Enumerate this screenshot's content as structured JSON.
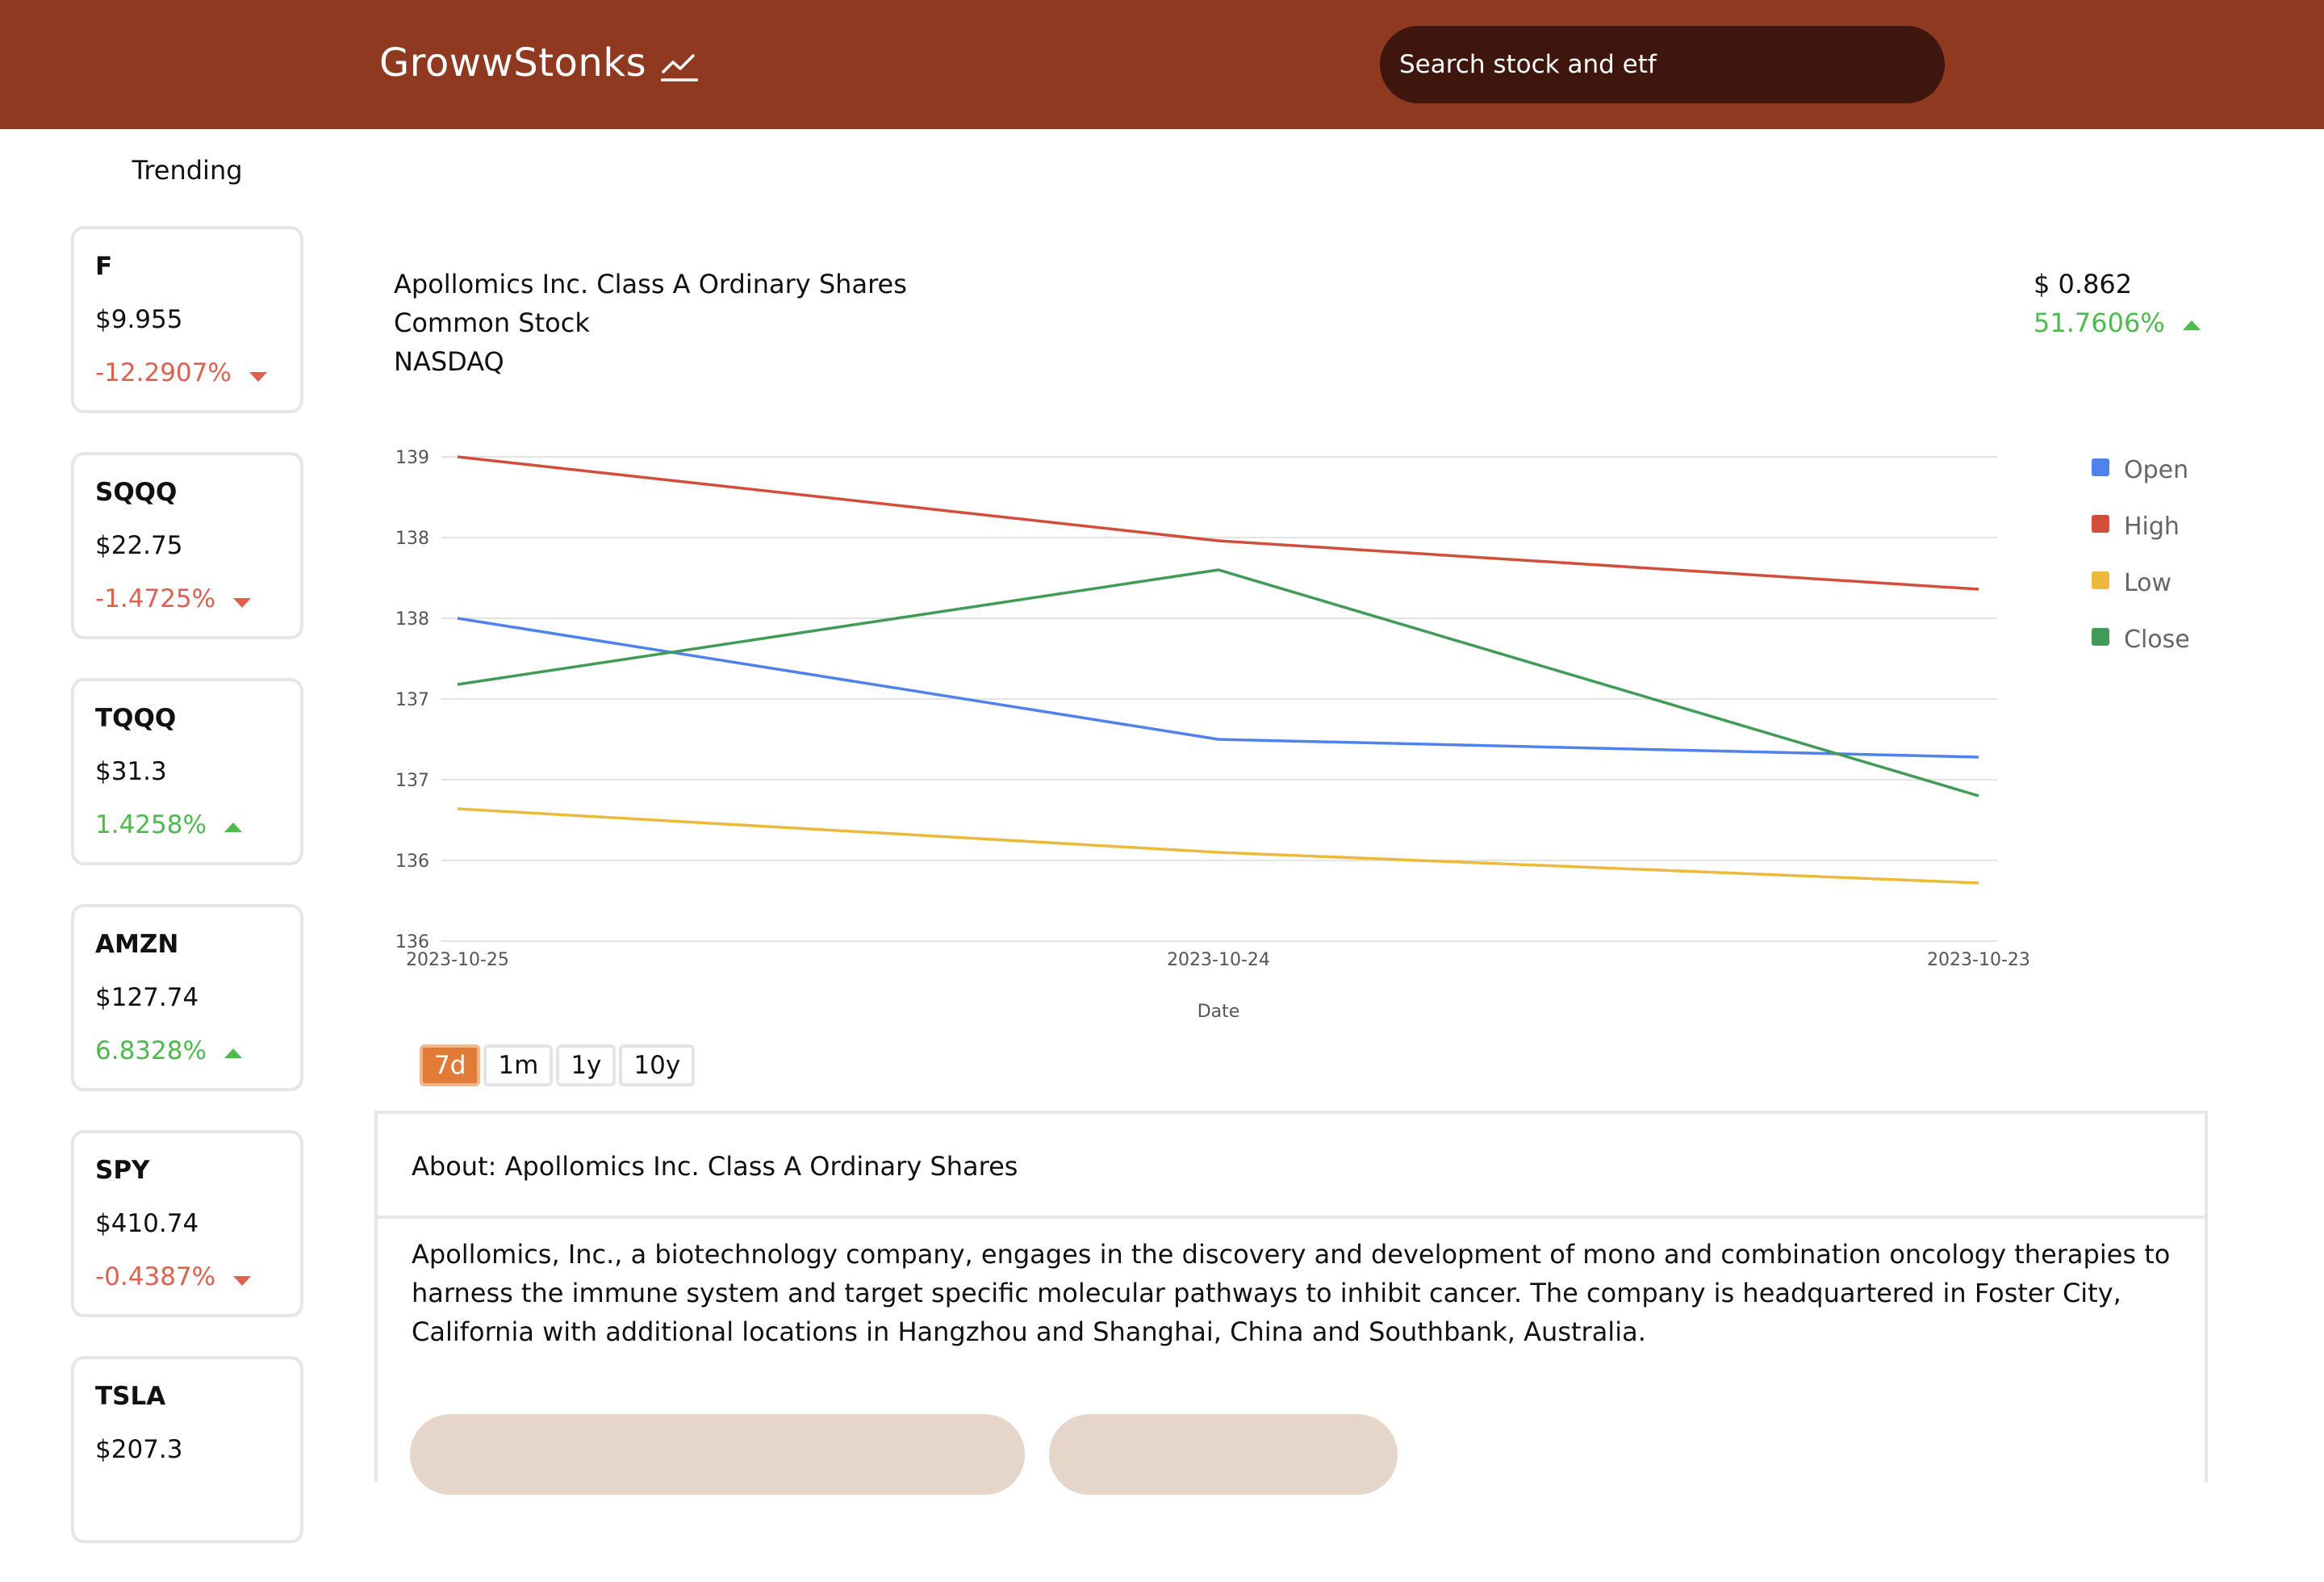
{
  "navbar": {
    "brand": "GrowwStonks",
    "brand_icon": "trending-chart-icon",
    "search_placeholder": "Search stock and etf",
    "background": "#8f3a20",
    "search_background": "#3e160d"
  },
  "trending": {
    "heading": "Trending",
    "items": [
      {
        "symbol": "F",
        "price": "$9.955",
        "change": "-12.2907%",
        "direction": "down"
      },
      {
        "symbol": "SQQQ",
        "price": "$22.75",
        "change": "-1.4725%",
        "direction": "down"
      },
      {
        "symbol": "TQQQ",
        "price": "$31.3",
        "change": "1.4258%",
        "direction": "up"
      },
      {
        "symbol": "AMZN",
        "price": "$127.74",
        "change": "6.8328%",
        "direction": "up"
      },
      {
        "symbol": "SPY",
        "price": "$410.74",
        "change": "-0.4387%",
        "direction": "down"
      },
      {
        "symbol": "TSLA",
        "price": "$207.3",
        "change": "",
        "direction": ""
      }
    ]
  },
  "stock": {
    "name": "Apollomics Inc. Class A Ordinary Shares",
    "asset_type": "Common Stock",
    "exchange": "NASDAQ",
    "price": "$ 0.862",
    "change": "51.7606%",
    "direction": "up"
  },
  "chart_data": {
    "type": "line",
    "x": [
      "2023-10-25",
      "2023-10-24",
      "2023-10-23"
    ],
    "xlabel": "Date",
    "ylabel": "",
    "ylim": [
      135.8,
      138.8
    ],
    "y_ticks": [
      135.8,
      136.3,
      136.8,
      137.3,
      137.8,
      138.3,
      138.8
    ],
    "y_tick_labels": [
      "136",
      "136",
      "137",
      "137",
      "138",
      "138",
      "139"
    ],
    "grid": true,
    "legend_position": "right",
    "series": [
      {
        "name": "Open",
        "color": "#5082ee",
        "values": [
          137.8,
          137.05,
          136.94
        ]
      },
      {
        "name": "High",
        "color": "#d24d3a",
        "values": [
          138.8,
          138.28,
          137.98
        ]
      },
      {
        "name": "Low",
        "color": "#ecb93a",
        "values": [
          136.62,
          136.35,
          136.16
        ]
      },
      {
        "name": "Close",
        "color": "#3f9b55",
        "values": [
          137.39,
          138.1,
          136.7
        ]
      }
    ]
  },
  "range_buttons": [
    {
      "label": "7d",
      "active": true
    },
    {
      "label": "1m",
      "active": false
    },
    {
      "label": "1y",
      "active": false
    },
    {
      "label": "10y",
      "active": false
    }
  ],
  "about": {
    "title": "About: Apollomics Inc. Class A Ordinary Shares",
    "description": "Apollomics, Inc., a biotechnology company, engages in the discovery and development of mono and combination oncology therapies to harness the immune system and target specific molecular pathways to inhibit cancer. The company is headquartered in Foster City, California with additional locations in Hangzhou and Shanghai, China and Southbank, Australia."
  }
}
